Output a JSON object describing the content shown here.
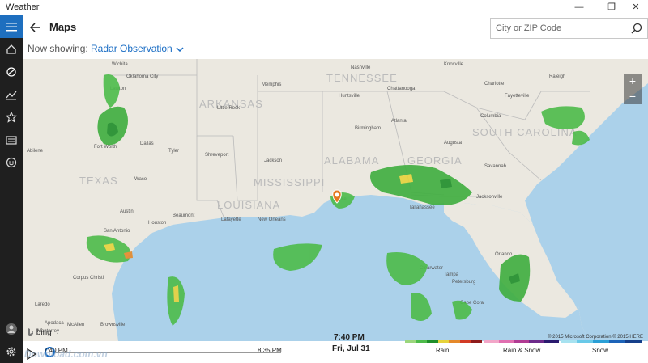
{
  "window": {
    "title": "Weather",
    "controls": [
      "minimize",
      "maximize",
      "close"
    ]
  },
  "nav_rail": {
    "items": [
      {
        "name": "menu-icon",
        "active": true
      },
      {
        "name": "home-icon"
      },
      {
        "name": "maps-icon"
      },
      {
        "name": "historical-icon"
      },
      {
        "name": "places-icon"
      },
      {
        "name": "news-icon"
      },
      {
        "name": "feedback-icon"
      }
    ],
    "bottom": [
      {
        "name": "account-icon"
      },
      {
        "name": "settings-icon"
      }
    ]
  },
  "header": {
    "title": "Maps",
    "search_placeholder": "City or ZIP Code"
  },
  "layer_selector": {
    "label": "Now showing:",
    "value": "Radar Observation"
  },
  "map": {
    "states": [
      "TENNESSEE",
      "ARKANSAS",
      "ALABAMA",
      "GEORGIA",
      "SOUTH CAROLINA",
      "TEXAS",
      "LOUISIANA",
      "MISSISSIPPI"
    ],
    "cities": [
      "Oklahoma City",
      "Wichita",
      "Memphis",
      "Nashville",
      "Knoxville",
      "Charlotte",
      "Fayetteville",
      "Raleigh",
      "Columbia",
      "Chattanooga",
      "Atlanta",
      "Birmingham",
      "Huntsville",
      "Little Rock",
      "Fort Worth",
      "Dallas",
      "Abilene",
      "Waco",
      "Shreveport",
      "Jackson",
      "Austin",
      "San Antonio",
      "Houston",
      "Beaumont",
      "Lafayette",
      "New Orleans",
      "Mobile",
      "Tallahassee",
      "Jacksonville",
      "Savannah",
      "Orlando",
      "Tampa",
      "Clearwater",
      "Petersburg",
      "Cape Coral",
      "Laredo",
      "Corpus Christi",
      "Brownsville",
      "McAllen",
      "Apodaca",
      "Monterrey",
      "Lawton",
      "Tyler",
      "Augusta"
    ],
    "zoom_in": "+",
    "zoom_out": "−",
    "bing_label": "bing",
    "copyright": "© 2015 Microsoft Corporation    © 2015 HERE"
  },
  "player": {
    "start_time": "7:40 PM",
    "end_time": "8:35 PM",
    "current_time": "7:40 PM",
    "current_date": "Fri, Jul 31",
    "progress": 0
  },
  "legend": [
    {
      "label": "Rain",
      "colors": [
        "#9bd67c",
        "#4dbb4a",
        "#1e8e2a",
        "#e6d23b",
        "#e5892a",
        "#d23b25",
        "#8e1b1b"
      ]
    },
    {
      "label": "Rain & Snow",
      "colors": [
        "#f2a6c8",
        "#e06fb0",
        "#b13b93",
        "#6d2a8a",
        "#2a1a6e"
      ]
    },
    {
      "label": "Snow",
      "colors": [
        "#a7e2f0",
        "#69c9e8",
        "#2a9fd6",
        "#1c63b8",
        "#153f8a"
      ]
    }
  ],
  "watermark": "Download.com.vn"
}
